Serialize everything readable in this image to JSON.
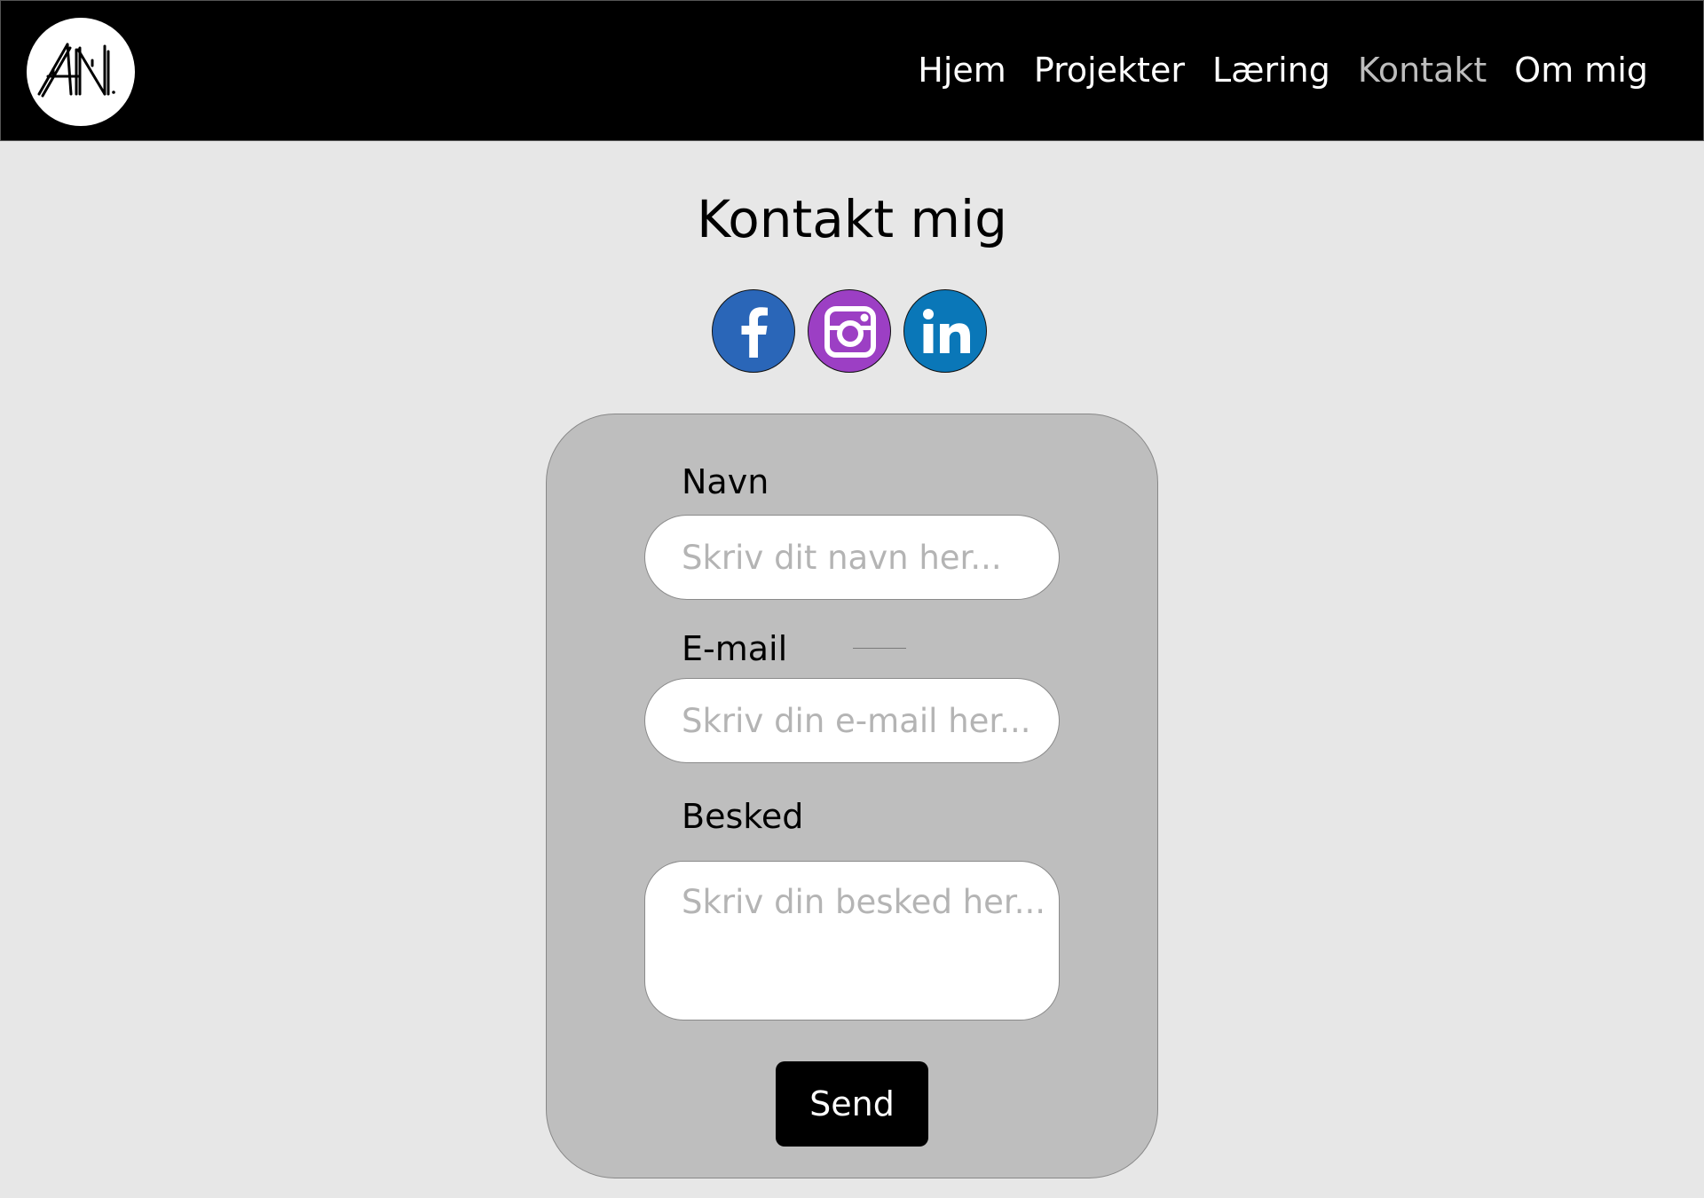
{
  "header": {
    "logo_text": "AN",
    "nav": [
      {
        "label": "Hjem",
        "active": false
      },
      {
        "label": "Projekter",
        "active": false
      },
      {
        "label": "Læring",
        "active": false
      },
      {
        "label": "Kontakt",
        "active": true
      },
      {
        "label": "Om mig",
        "active": false
      }
    ]
  },
  "main": {
    "title": "Kontakt mig",
    "social": [
      {
        "name": "facebook",
        "icon": "facebook-icon",
        "color": "#2a66b8"
      },
      {
        "name": "instagram",
        "icon": "instagram-icon",
        "color": "#9c3fc4"
      },
      {
        "name": "linkedin",
        "icon": "linkedin-icon",
        "color": "#0a77b8"
      }
    ]
  },
  "form": {
    "name_label": "Navn",
    "name_placeholder": "Skriv dit navn her...",
    "email_label": "E-mail",
    "email_placeholder": "Skriv din e-mail her...",
    "message_label": "Besked",
    "message_placeholder": "Skriv din besked her...",
    "send_label": "Send"
  },
  "colors": {
    "header_bg": "#000000",
    "page_bg": "#e7e7e7",
    "card_bg": "#bebebe",
    "nav_active": "#bdbdbd",
    "button_bg": "#000000"
  }
}
